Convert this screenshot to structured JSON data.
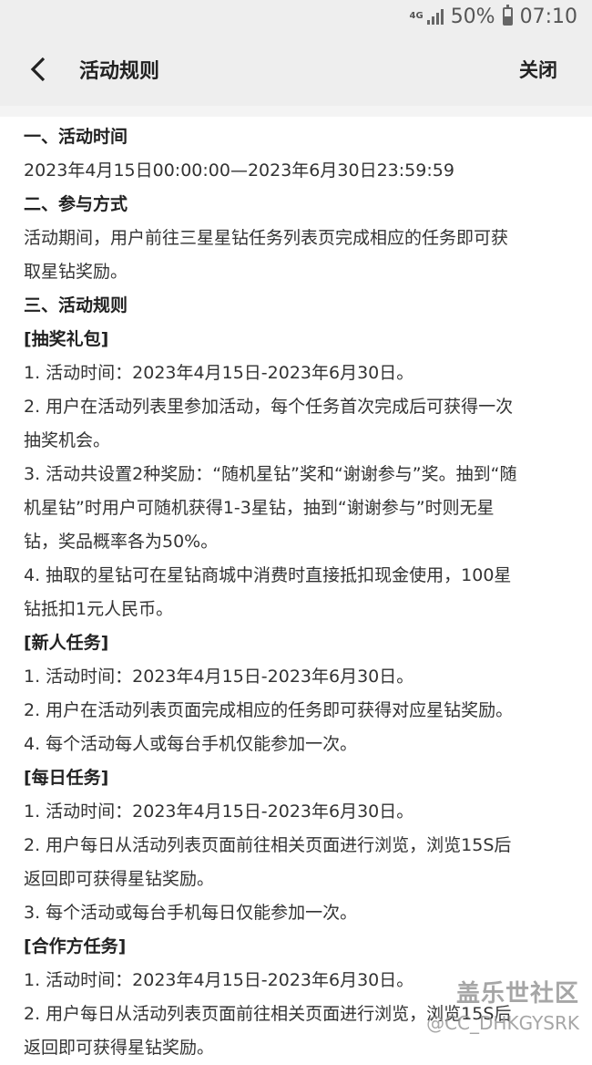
{
  "status_bar": {
    "network": "4G",
    "battery": "50%",
    "battery_level": 0.5,
    "time": "07:10"
  },
  "app_bar": {
    "title": "活动规则",
    "close_label": "关闭"
  },
  "content": {
    "lines": [
      {
        "text": "一、活动时间",
        "heading": true
      },
      {
        "text": "2023年4月15日00:00:00—2023年6月30日23:59:59",
        "heading": false
      },
      {
        "text": "二、参与方式",
        "heading": true
      },
      {
        "text": "活动期间，用户前往三星星钻任务列表页完成相应的任务即可获",
        "heading": false
      },
      {
        "text": "取星钻奖励。",
        "heading": false
      },
      {
        "text": "三、活动规则",
        "heading": true
      },
      {
        "text": "[抽奖礼包]",
        "heading": true
      },
      {
        "text": "1. 活动时间：2023年4月15日-2023年6月30日。",
        "heading": false
      },
      {
        "text": "2. 用户在活动列表里参加活动，每个任务首次完成后可获得一次",
        "heading": false
      },
      {
        "text": "抽奖机会。",
        "heading": false
      },
      {
        "text": "3. 活动共设置2种奖励：“随机星钻”奖和“谢谢参与”奖。抽到“随",
        "heading": false
      },
      {
        "text": "机星钻”时用户可随机获得1-3星钻，抽到“谢谢参与”时则无星",
        "heading": false
      },
      {
        "text": "钻，奖品概率各为50%。",
        "heading": false
      },
      {
        "text": "4. 抽取的星钻可在星钻商城中消费时直接抵扣现金使用，100星",
        "heading": false
      },
      {
        "text": "钻抵扣1元人民币。",
        "heading": false
      },
      {
        "text": "[新人任务]",
        "heading": true
      },
      {
        "text": "1. 活动时间：2023年4月15日-2023年6月30日。",
        "heading": false
      },
      {
        "text": "2. 用户在活动列表页面完成相应的任务即可获得对应星钻奖励。",
        "heading": false
      },
      {
        "text": "4. 每个活动每人或每台手机仅能参加一次。",
        "heading": false
      },
      {
        "text": "[每日任务]",
        "heading": true
      },
      {
        "text": "1. 活动时间：2023年4月15日-2023年6月30日。",
        "heading": false
      },
      {
        "text": "2. 用户每日从活动列表页面前往相关页面进行浏览，浏览15S后",
        "heading": false
      },
      {
        "text": "返回即可获得星钻奖励。",
        "heading": false
      },
      {
        "text": "3. 每个活动或每台手机每日仅能参加一次。",
        "heading": false
      },
      {
        "text": "[合作方任务]",
        "heading": true
      },
      {
        "text": "1. 活动时间：2023年4月15日-2023年6月30日。",
        "heading": false
      },
      {
        "text": "2. 用户每日从活动列表页面前往相关页面进行浏览，浏览15S后",
        "heading": false
      },
      {
        "text": "返回即可获得星钻奖励。",
        "heading": false
      }
    ]
  },
  "watermark": {
    "title": "盖乐世社区",
    "user": "@CC_DHKGYSRK"
  }
}
